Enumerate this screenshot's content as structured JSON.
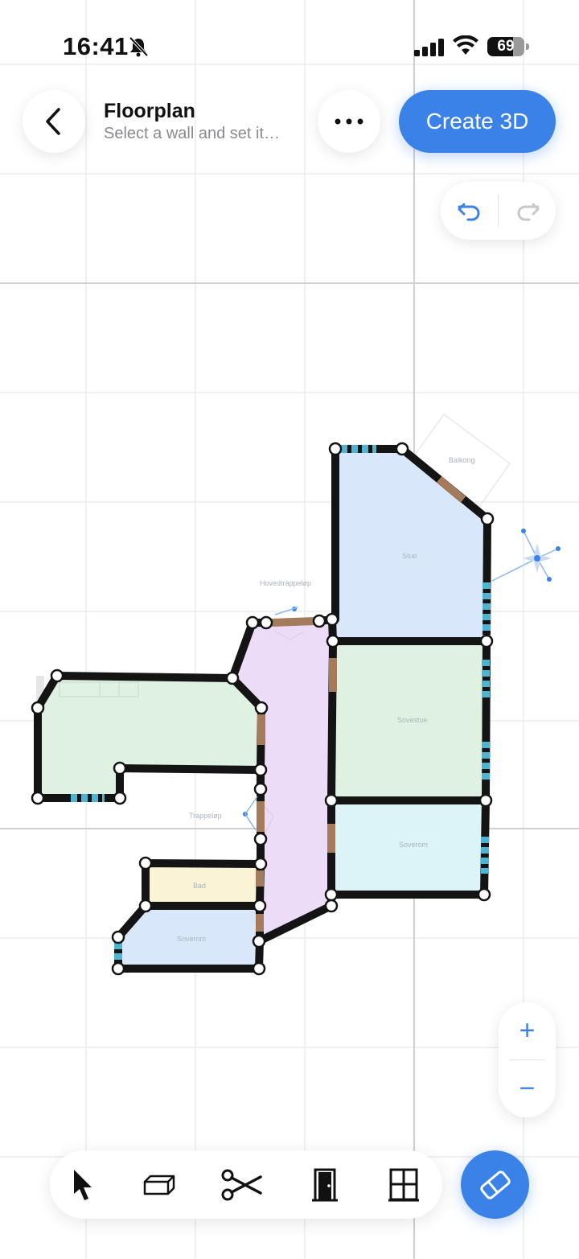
{
  "status_bar": {
    "time": "16:41",
    "battery_level": "69",
    "icons": [
      "bell-slash-icon",
      "cellular-signal-icon",
      "wifi-icon",
      "battery-icon"
    ]
  },
  "header": {
    "title": "Floorplan",
    "subtitle": "Select a wall and set it…",
    "create_label": "Create 3D",
    "back_icon": "chevron-left-icon",
    "more_icon": "ellipsis-icon"
  },
  "history": {
    "undo_icon": "undo-icon",
    "redo_icon": "redo-icon"
  },
  "floorplan": {
    "room_labels": {
      "balcony": "Balkong",
      "living": "Stue",
      "main_stair": "Hovedtrappeløp",
      "living2": "Sovestue",
      "bedroom1": "Soverom",
      "stair2": "Trappeløp",
      "bath": "Bad",
      "bedroom2": "Soverom"
    },
    "colors": {
      "wall": "#141414",
      "window": "#4fb3d1",
      "door": "#a57c5b",
      "room_blue": "#d8e8fa",
      "room_green": "#dff2e1",
      "room_purple": "#ecdcf7",
      "room_cyan": "#dcf3f7",
      "room_yellow": "#fbf3d6"
    }
  },
  "zoom": {
    "in_label": "+",
    "out_label": "−"
  },
  "toolbar": {
    "tools": [
      "select-arrow-icon",
      "wall-block-icon",
      "scissors-icon",
      "door-icon",
      "window-icon"
    ],
    "active_tool": "eraser-icon",
    "accent": "#3b82e8"
  }
}
